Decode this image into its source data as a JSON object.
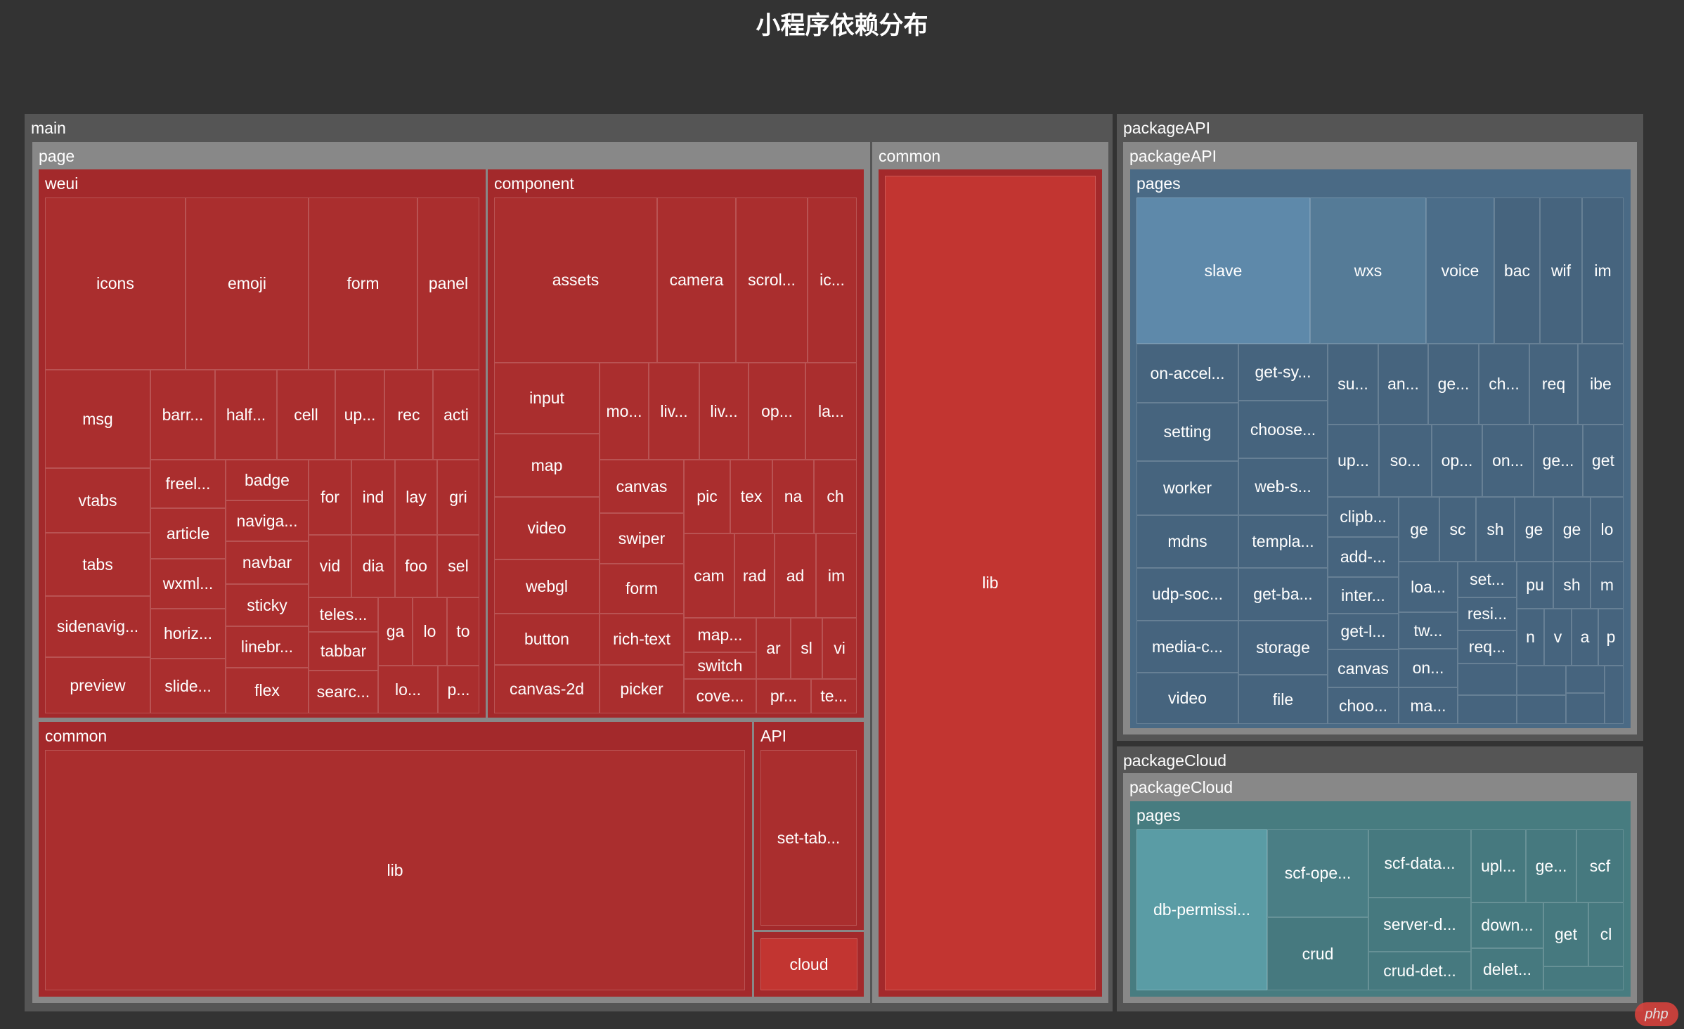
{
  "chart_data": {
    "type": "treemap",
    "title": "小程序依赖分布",
    "colors": {
      "background": "#333333",
      "main": "#c23531",
      "packageAPI": "#4a6a85",
      "packageCloud": "#477c80"
    },
    "tree": [
      {
        "name": "main",
        "children": [
          {
            "name": "page",
            "children": [
              {
                "name": "weui",
                "children": [
                  {
                    "name": "icons"
                  },
                  {
                    "name": "emoji"
                  },
                  {
                    "name": "form"
                  },
                  {
                    "name": "panel"
                  },
                  {
                    "name": "msg"
                  },
                  {
                    "name": "vtabs"
                  },
                  {
                    "name": "tabs"
                  },
                  {
                    "name": "sidenavig..."
                  },
                  {
                    "name": "preview"
                  },
                  {
                    "name": "barr..."
                  },
                  {
                    "name": "half..."
                  },
                  {
                    "name": "cell"
                  },
                  {
                    "name": "up..."
                  },
                  {
                    "name": "rec"
                  },
                  {
                    "name": "acti"
                  },
                  {
                    "name": "freel..."
                  },
                  {
                    "name": "article"
                  },
                  {
                    "name": "wxml..."
                  },
                  {
                    "name": "horiz..."
                  },
                  {
                    "name": "slide..."
                  },
                  {
                    "name": "badge"
                  },
                  {
                    "name": "naviga..."
                  },
                  {
                    "name": "navbar"
                  },
                  {
                    "name": "sticky"
                  },
                  {
                    "name": "linebr..."
                  },
                  {
                    "name": "flex"
                  },
                  {
                    "name": "for"
                  },
                  {
                    "name": "ind"
                  },
                  {
                    "name": "lay"
                  },
                  {
                    "name": "gri"
                  },
                  {
                    "name": "vid"
                  },
                  {
                    "name": "dia"
                  },
                  {
                    "name": "foo"
                  },
                  {
                    "name": "sel"
                  },
                  {
                    "name": "teles..."
                  },
                  {
                    "name": "tabbar"
                  },
                  {
                    "name": "searc..."
                  },
                  {
                    "name": "ga"
                  },
                  {
                    "name": "lo"
                  },
                  {
                    "name": "to"
                  },
                  {
                    "name": "lo..."
                  },
                  {
                    "name": "p..."
                  }
                ]
              },
              {
                "name": "component",
                "children": [
                  {
                    "name": "assets"
                  },
                  {
                    "name": "camera"
                  },
                  {
                    "name": "scrol..."
                  },
                  {
                    "name": "ic..."
                  },
                  {
                    "name": "input"
                  },
                  {
                    "name": "map"
                  },
                  {
                    "name": "video"
                  },
                  {
                    "name": "webgl"
                  },
                  {
                    "name": "button"
                  },
                  {
                    "name": "canvas-2d"
                  },
                  {
                    "name": "mo..."
                  },
                  {
                    "name": "liv..."
                  },
                  {
                    "name": "liv..."
                  },
                  {
                    "name": "op..."
                  },
                  {
                    "name": "la..."
                  },
                  {
                    "name": "canvas"
                  },
                  {
                    "name": "swiper"
                  },
                  {
                    "name": "form"
                  },
                  {
                    "name": "rich-text"
                  },
                  {
                    "name": "picker"
                  },
                  {
                    "name": "pic"
                  },
                  {
                    "name": "tex"
                  },
                  {
                    "name": "na"
                  },
                  {
                    "name": "ch"
                  },
                  {
                    "name": "cam"
                  },
                  {
                    "name": "rad"
                  },
                  {
                    "name": "ad"
                  },
                  {
                    "name": "im"
                  },
                  {
                    "name": "map..."
                  },
                  {
                    "name": "switch"
                  },
                  {
                    "name": "cove..."
                  },
                  {
                    "name": "ar"
                  },
                  {
                    "name": "sl"
                  },
                  {
                    "name": "vi"
                  },
                  {
                    "name": "pr..."
                  },
                  {
                    "name": "te..."
                  }
                ]
              },
              {
                "name": "common",
                "children": [
                  {
                    "name": "lib"
                  }
                ]
              },
              {
                "name": "API",
                "children": [
                  {
                    "name": "set-tab..."
                  }
                ]
              },
              {
                "name": "cloud"
              }
            ]
          },
          {
            "name": "common",
            "children": [
              {
                "name": "lib"
              }
            ]
          }
        ]
      },
      {
        "name": "packageAPI",
        "children": [
          {
            "name": "packageAPI",
            "children": [
              {
                "name": "pages",
                "children": [
                  {
                    "name": "slave"
                  },
                  {
                    "name": "wxs"
                  },
                  {
                    "name": "voice"
                  },
                  {
                    "name": "bac"
                  },
                  {
                    "name": "wif"
                  },
                  {
                    "name": "im"
                  },
                  {
                    "name": "on-accel..."
                  },
                  {
                    "name": "setting"
                  },
                  {
                    "name": "worker"
                  },
                  {
                    "name": "mdns"
                  },
                  {
                    "name": "udp-soc..."
                  },
                  {
                    "name": "media-c..."
                  },
                  {
                    "name": "video"
                  },
                  {
                    "name": "get-sy..."
                  },
                  {
                    "name": "choose..."
                  },
                  {
                    "name": "web-s..."
                  },
                  {
                    "name": "templa..."
                  },
                  {
                    "name": "get-ba..."
                  },
                  {
                    "name": "storage"
                  },
                  {
                    "name": "file"
                  },
                  {
                    "name": "su..."
                  },
                  {
                    "name": "an..."
                  },
                  {
                    "name": "ge..."
                  },
                  {
                    "name": "ch..."
                  },
                  {
                    "name": "req"
                  },
                  {
                    "name": "ibe"
                  },
                  {
                    "name": "up..."
                  },
                  {
                    "name": "so..."
                  },
                  {
                    "name": "op..."
                  },
                  {
                    "name": "on..."
                  },
                  {
                    "name": "ge..."
                  },
                  {
                    "name": "get"
                  },
                  {
                    "name": "clipb..."
                  },
                  {
                    "name": "add-..."
                  },
                  {
                    "name": "inter..."
                  },
                  {
                    "name": "get-l..."
                  },
                  {
                    "name": "canvas"
                  },
                  {
                    "name": "choo..."
                  },
                  {
                    "name": "ge"
                  },
                  {
                    "name": "sc"
                  },
                  {
                    "name": "sh"
                  },
                  {
                    "name": "ge"
                  },
                  {
                    "name": "ge"
                  },
                  {
                    "name": "lo"
                  },
                  {
                    "name": "loa..."
                  },
                  {
                    "name": "tw..."
                  },
                  {
                    "name": "on..."
                  },
                  {
                    "name": "ma..."
                  },
                  {
                    "name": "set..."
                  },
                  {
                    "name": "resi..."
                  },
                  {
                    "name": "req..."
                  },
                  {
                    "name": "pu"
                  },
                  {
                    "name": "sh"
                  },
                  {
                    "name": "m"
                  },
                  {
                    "name": "n"
                  },
                  {
                    "name": "v"
                  },
                  {
                    "name": "a"
                  },
                  {
                    "name": "p"
                  }
                ]
              }
            ]
          }
        ]
      },
      {
        "name": "packageCloud",
        "children": [
          {
            "name": "packageCloud",
            "children": [
              {
                "name": "pages",
                "children": [
                  {
                    "name": "db-permissi..."
                  },
                  {
                    "name": "scf-ope..."
                  },
                  {
                    "name": "crud"
                  },
                  {
                    "name": "scf-data..."
                  },
                  {
                    "name": "server-d..."
                  },
                  {
                    "name": "crud-det..."
                  },
                  {
                    "name": "upl..."
                  },
                  {
                    "name": "ge..."
                  },
                  {
                    "name": "scf"
                  },
                  {
                    "name": "down..."
                  },
                  {
                    "name": "delet..."
                  },
                  {
                    "name": "get"
                  },
                  {
                    "name": "cl"
                  }
                ]
              }
            ]
          }
        ]
      }
    ]
  }
}
